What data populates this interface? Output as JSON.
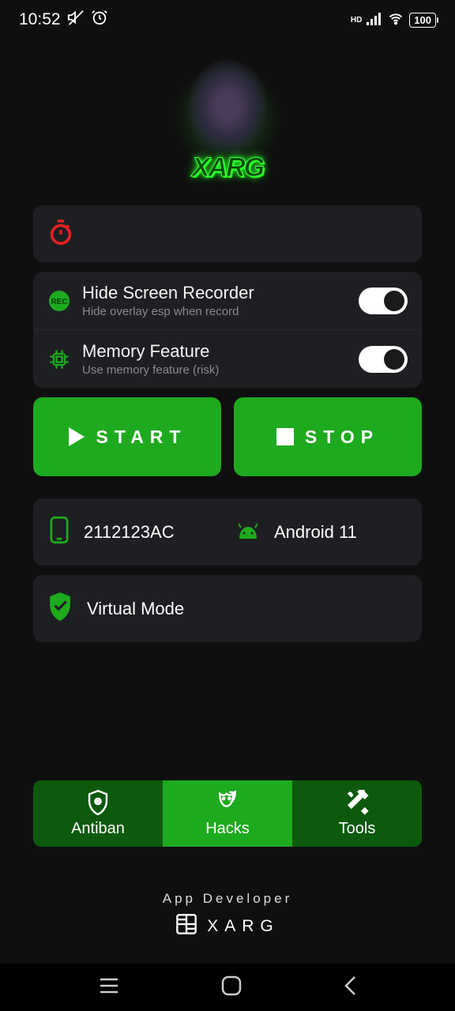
{
  "status": {
    "time": "10:52",
    "battery": "100",
    "hd": "HD"
  },
  "logo": {
    "text": "XARG"
  },
  "toggles": {
    "recorder": {
      "title": "Hide Screen Recorder",
      "sub": "Hide overlay esp when record"
    },
    "memory": {
      "title": "Memory Feature",
      "sub": "Use memory feature (risk)"
    }
  },
  "buttons": {
    "start": "START",
    "stop": "STOP"
  },
  "device": {
    "model": "2112123AC",
    "os": "Android 11",
    "mode": "Virtual Mode"
  },
  "tabs": {
    "antiban": "Antiban",
    "hacks": "Hacks",
    "tools": "Tools"
  },
  "footer": {
    "top": "App Developer",
    "bottom": "XARG"
  }
}
